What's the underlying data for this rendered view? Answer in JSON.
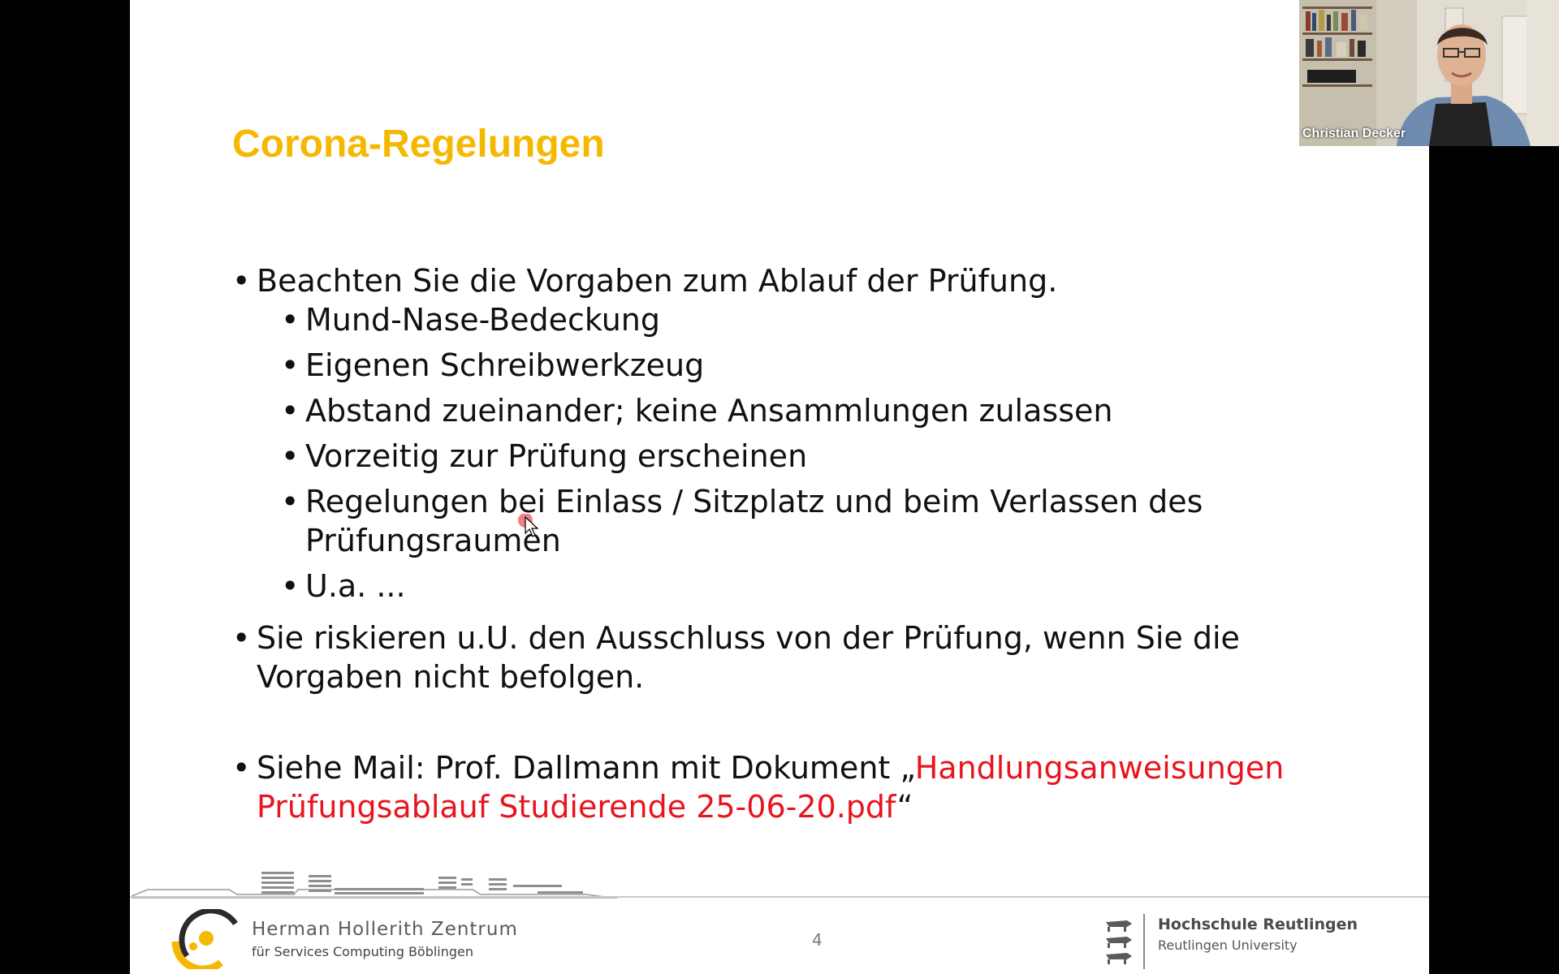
{
  "slide": {
    "title": "Corona-Regelungen",
    "bullets": {
      "b1": "Beachten Sie die Vorgaben zum Ablauf der Prüfung.",
      "b1_sub": [
        "Mund-Nase-Bedeckung",
        "Eigenen Schreibwerkzeug",
        "Abstand zueinander; keine Ansammlungen zulassen",
        "Vorzeitig zur Prüfung erscheinen",
        "Regelungen bei Einlass / Sitzplatz und beim Verlassen des Prüfungsraumen",
        "U.a. ..."
      ],
      "b2": "Sie riskieren u.U. den Ausschluss von der Prüfung, wenn Sie die Vorgaben nicht befolgen.",
      "b3_prefix": "Siehe Mail: Prof. Dallmann mit Dokument „",
      "b3_link": "Handlungsanweisungen Prüfungsablauf Studierende 25-06-20.pdf",
      "b3_suffix": "“"
    },
    "footer": {
      "org_name": "Herman Hollerith Zentrum",
      "org_sub": "für Services Computing Böblingen",
      "page_number": "4",
      "univ_name": "Hochschule Reutlingen",
      "univ_sub": "Reutlingen University"
    }
  },
  "webcam": {
    "participant_name": "Christian Decker"
  },
  "colors": {
    "title": "#f5b800",
    "link": "#e8141e",
    "background": "#000000"
  }
}
